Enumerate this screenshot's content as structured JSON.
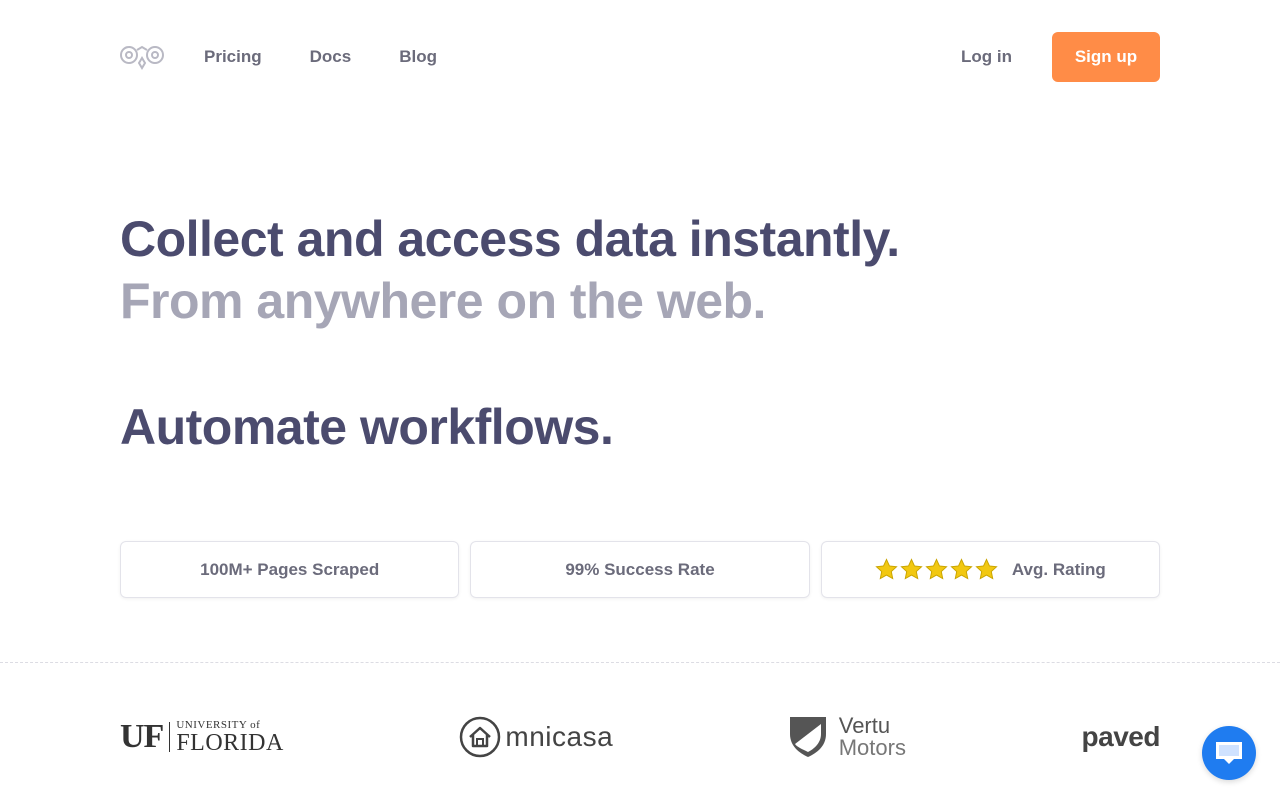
{
  "nav": {
    "links": [
      "Pricing",
      "Docs",
      "Blog"
    ],
    "login": "Log in",
    "signup": "Sign up"
  },
  "hero": {
    "line1": "Collect and access data instantly.",
    "line2": "From anywhere on the web.",
    "line3": "Automate workflows."
  },
  "stats": {
    "pages": "100M+ Pages Scraped",
    "success": "99% Success Rate",
    "rating_label": "Avg. Rating",
    "rating_stars": 5
  },
  "logos": {
    "uf_mark": "UF",
    "uf_small": "UNIVERSITY of",
    "uf_big": "FLORIDA",
    "omnicasa": "mnicasa",
    "vertu_1": "Vertu",
    "vertu_2": "Motors",
    "paved": "paved"
  },
  "colors": {
    "accent": "#ff8c47",
    "heading": "#4b4b6e",
    "heading_muted": "#a6a6b6",
    "chat": "#1f7cf0",
    "star": "#f2c811"
  },
  "icons": {
    "logo": "robot-eyes-icon",
    "star": "star-icon",
    "chat": "chat-bubble-icon"
  }
}
